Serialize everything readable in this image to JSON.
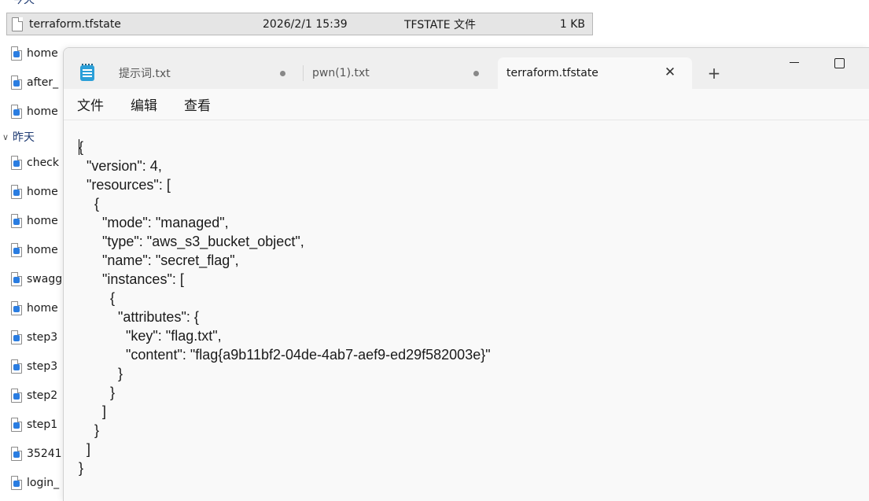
{
  "explorer": {
    "group_today_partial": "今天",
    "group_yesterday": "昨天",
    "selected_file": {
      "name": "terraform.tfstate",
      "date": "2026/2/1 15:39",
      "type": "TFSTATE 文件",
      "size": "1 KB"
    },
    "files_today": [
      "home",
      "after_",
      "home"
    ],
    "files_yesterday": [
      "check",
      "home",
      "home",
      "home",
      "swagg",
      "home",
      "step3",
      "step3",
      "step2",
      "step1",
      "35241",
      "login_"
    ]
  },
  "notepad": {
    "tabs": [
      {
        "label": "提示词.txt",
        "modified": true
      },
      {
        "label": "pwn(1).txt",
        "modified": true
      },
      {
        "label": "terraform.tfstate",
        "active": true
      }
    ],
    "new_tab_label": "+",
    "close_label": "✕",
    "menu": [
      "文件",
      "编辑",
      "查看"
    ],
    "content_lines": [
      "{",
      "  \"version\": 4,",
      "  \"resources\": [",
      "    {",
      "      \"mode\": \"managed\",",
      "      \"type\": \"aws_s3_bucket_object\",",
      "      \"name\": \"secret_flag\",",
      "      \"instances\": [",
      "        {",
      "          \"attributes\": {",
      "            \"key\": \"flag.txt\",",
      "            \"content\": \"flag{a9b11bf2-04de-4ab7-aef9-ed29f582003e}\"",
      "          }",
      "        }",
      "      ]",
      "    }",
      "  ]",
      "}"
    ]
  },
  "colors": {
    "accent": "#2a7de1",
    "selection": "#e5e5e5",
    "titlebar": "#efefef",
    "editor_bg": "#f9f9f9"
  },
  "icons": {
    "file": "file-icon",
    "app": "notepad-icon",
    "minimize": "minimize-icon",
    "maximize": "maximize-icon",
    "close": "close-icon",
    "add": "plus-icon",
    "modified": "unsaved-dot-icon",
    "chevron": "chevron-down-icon"
  }
}
